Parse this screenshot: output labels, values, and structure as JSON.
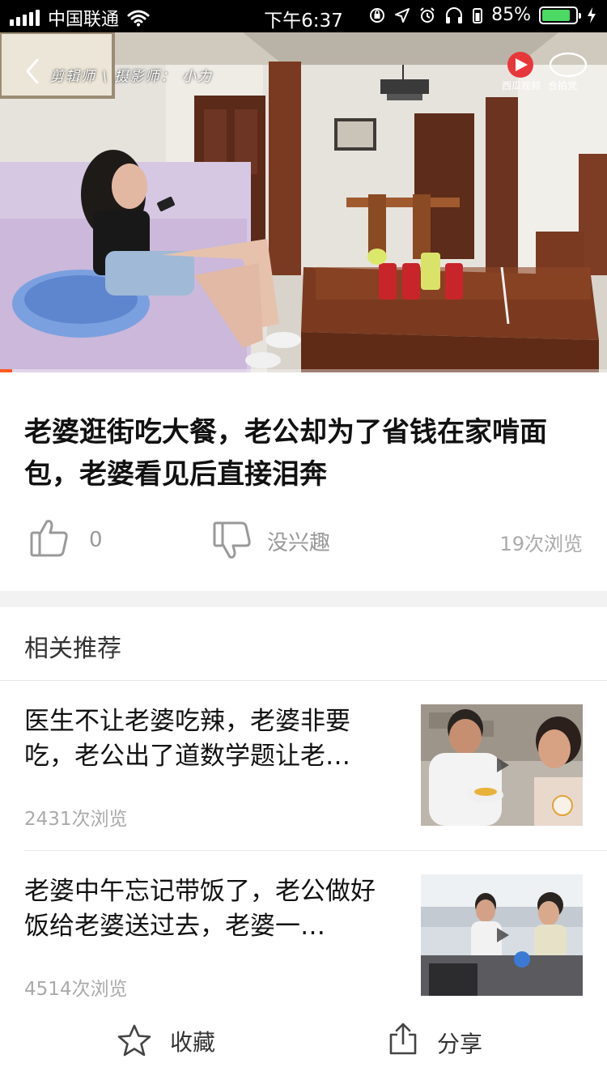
{
  "status_bar": {
    "carrier": "中国联通",
    "time": "下午6:37",
    "battery": "85%",
    "battery_level": 0.85,
    "accent_battery": "#4cd964"
  },
  "video": {
    "overlay_text": "剪辑师 \\ 摄影师： 小力",
    "progress": 0.02,
    "progress_color": "#ff5a1f"
  },
  "article": {
    "title": "老婆逛街吃大餐，老公却为了省钱在家啃面包，老婆看见后直接泪奔",
    "like_count": "0",
    "dislike_label": "没兴趣",
    "views": "19次浏览"
  },
  "related": {
    "heading": "相关推荐",
    "items": [
      {
        "title": "医生不让老婆吃辣，老婆非要吃，老公出了道数学题让老…",
        "views": "2431次浏览"
      },
      {
        "title": "老婆中午忘记带饭了，老公做好饭给老婆送过去，老婆一…",
        "views": "4514次浏览"
      }
    ]
  },
  "bottom_bar": {
    "favorite_label": "收藏",
    "share_label": "分享"
  }
}
